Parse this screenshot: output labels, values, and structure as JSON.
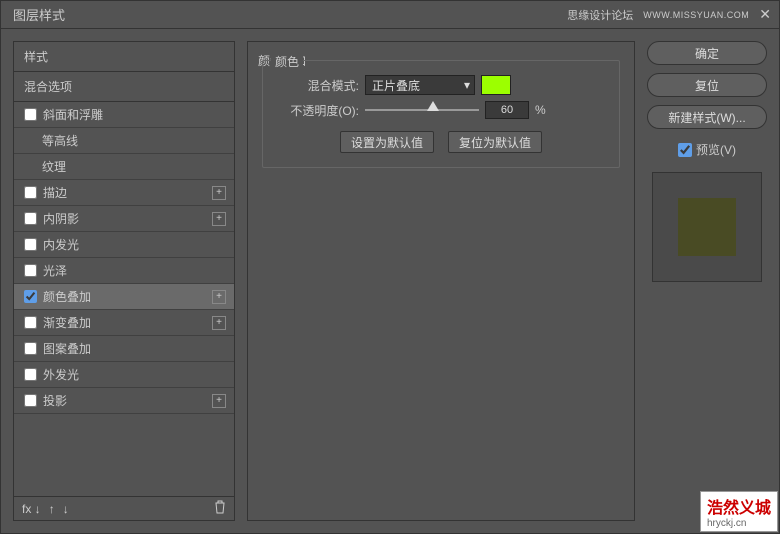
{
  "titlebar": {
    "title": "图层样式",
    "forum": "思缘设计论坛",
    "url": "WWW.MISSYUAN.COM"
  },
  "left": {
    "head1": "样式",
    "head2": "混合选项",
    "items": [
      {
        "label": "斜面和浮雕",
        "checked": false,
        "plus": false,
        "indent": 0
      },
      {
        "label": "等高线",
        "checked": false,
        "plus": false,
        "indent": 1,
        "noCheckbox": true
      },
      {
        "label": "纹理",
        "checked": false,
        "plus": false,
        "indent": 1,
        "noCheckbox": true
      },
      {
        "label": "描边",
        "checked": false,
        "plus": true,
        "indent": 0
      },
      {
        "label": "内阴影",
        "checked": false,
        "plus": true,
        "indent": 0
      },
      {
        "label": "内发光",
        "checked": false,
        "plus": false,
        "indent": 0
      },
      {
        "label": "光泽",
        "checked": false,
        "plus": false,
        "indent": 0
      },
      {
        "label": "颜色叠加",
        "checked": true,
        "plus": true,
        "indent": 0,
        "selected": true
      },
      {
        "label": "渐变叠加",
        "checked": false,
        "plus": true,
        "indent": 0
      },
      {
        "label": "图案叠加",
        "checked": false,
        "plus": false,
        "indent": 0
      },
      {
        "label": "外发光",
        "checked": false,
        "plus": false,
        "indent": 0
      },
      {
        "label": "投影",
        "checked": false,
        "plus": true,
        "indent": 0
      }
    ],
    "footer_fx": "fx"
  },
  "center": {
    "outer_title": "颜色叠加",
    "inner_title": "颜色",
    "blend_label": "混合模式:",
    "blend_value": "正片叠底",
    "color": "#9cff00",
    "opacity_label": "不透明度(O):",
    "opacity_value": "60",
    "opacity_pct": 60,
    "percent": "%",
    "btn_default": "设置为默认值",
    "btn_reset": "复位为默认值"
  },
  "right": {
    "ok": "确定",
    "cancel": "复位",
    "newstyle": "新建样式(W)...",
    "preview_label": "预览(V)",
    "preview_checked": true
  },
  "watermark": {
    "main": "浩然义城",
    "sub": "hryckj.cn"
  }
}
